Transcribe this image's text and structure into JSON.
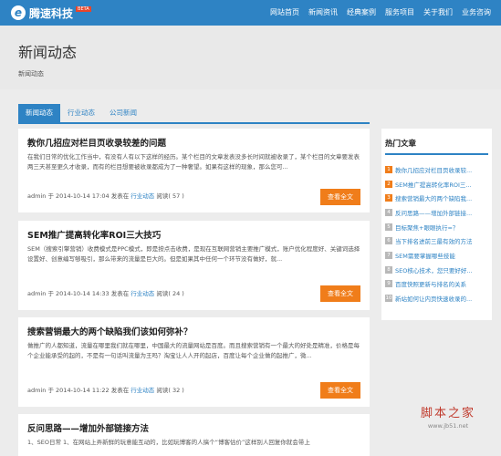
{
  "brand": {
    "name": "腾速科技",
    "badge": "BETA"
  },
  "nav": [
    "网站首页",
    "新闻资讯",
    "经典案例",
    "服务项目",
    "关于我们",
    "业务咨询"
  ],
  "page": {
    "title": "新闻动态",
    "crumb": "新闻动态"
  },
  "tabs": [
    "新闻动态",
    "行业动态",
    "公司新闻"
  ],
  "articles": [
    {
      "title": "教你几招应对栏目页收录较差的问题",
      "summary": "在我们日常的优化工作当中，有没有人有以下这样的经历。某个栏目的文章发表没多长时间就被收录了，某个栏目的文章要发表两三天甚至更久才收录，而有的栏目想要被收录都成为了一种奢望。如果有这样的现象，那么您可...",
      "author": "admin",
      "yu": "于",
      "date": "2014-10-14 17:04",
      "pub": "发表在",
      "category": "行业动态",
      "reads": "阅读( 57 )",
      "button": "查看全文"
    },
    {
      "title": "SEM推广提高转化率ROI三大技巧",
      "summary": "SEM（搜索引擎营销）收费模式是PPC模式，即是按点击收费，是现在互联网营销主要推广模式，账户优化程度好、关键词选择设置好、创意编写够吸引，那么带来的流量是巨大的。但是如果其中任何一个环节没有做好，就...",
      "author": "admin",
      "yu": "于",
      "date": "2014-10-14 14:33",
      "pub": "发表在",
      "category": "行业动态",
      "reads": "阅读( 24 )",
      "button": "查看全文"
    },
    {
      "title": "搜索营销最大的两个缺陷我们该如何弥补？",
      "summary": "做推广的人都知道，流量在哪里我们就在哪里，中国最大的流量网站是百度。而且搜索营销有一个最大的好处是精准，价格是每个企业能承受的起的，不是有一句话叫流量为王吗？淘宝让人人开的起店，百度让每个企业做的起推广，微...",
      "author": "admin",
      "yu": "于",
      "date": "2014-10-14 11:22",
      "pub": "发表在",
      "category": "行业动态",
      "reads": "阅读( 32 )",
      "button": "查看全文"
    },
    {
      "title": "反问思路——增加外部链接方法",
      "summary": "1、SEO日常    1、在网站上弄新鲜的玩意能互动的，比如玩博客的人搞个“博客估价”这样别人回复你就会带上"
    }
  ],
  "sidebar": {
    "title": "热门文章",
    "items": [
      "教你几招应对栏目页收录较...",
      "SEM推广提高转化率ROI三...",
      "搜索营销最大的两个缺陷我...",
      "反问思路——增加外部链接...",
      "目标聚焦+眼眼执行=？",
      "当下排名进前三最有效的方法",
      "SEM需要掌握哪些技能",
      "SEO核心技术，您只要好好...",
      "百度快照更新与排名的关系",
      "新站如何让内页快速收录的..."
    ]
  },
  "watermark": {
    "main": "脚本之家",
    "url": "www.jb51.net"
  },
  "colors": {
    "primary": "#2e83c4",
    "accent": "#f07d1a",
    "muted": "#b8b8b8"
  }
}
